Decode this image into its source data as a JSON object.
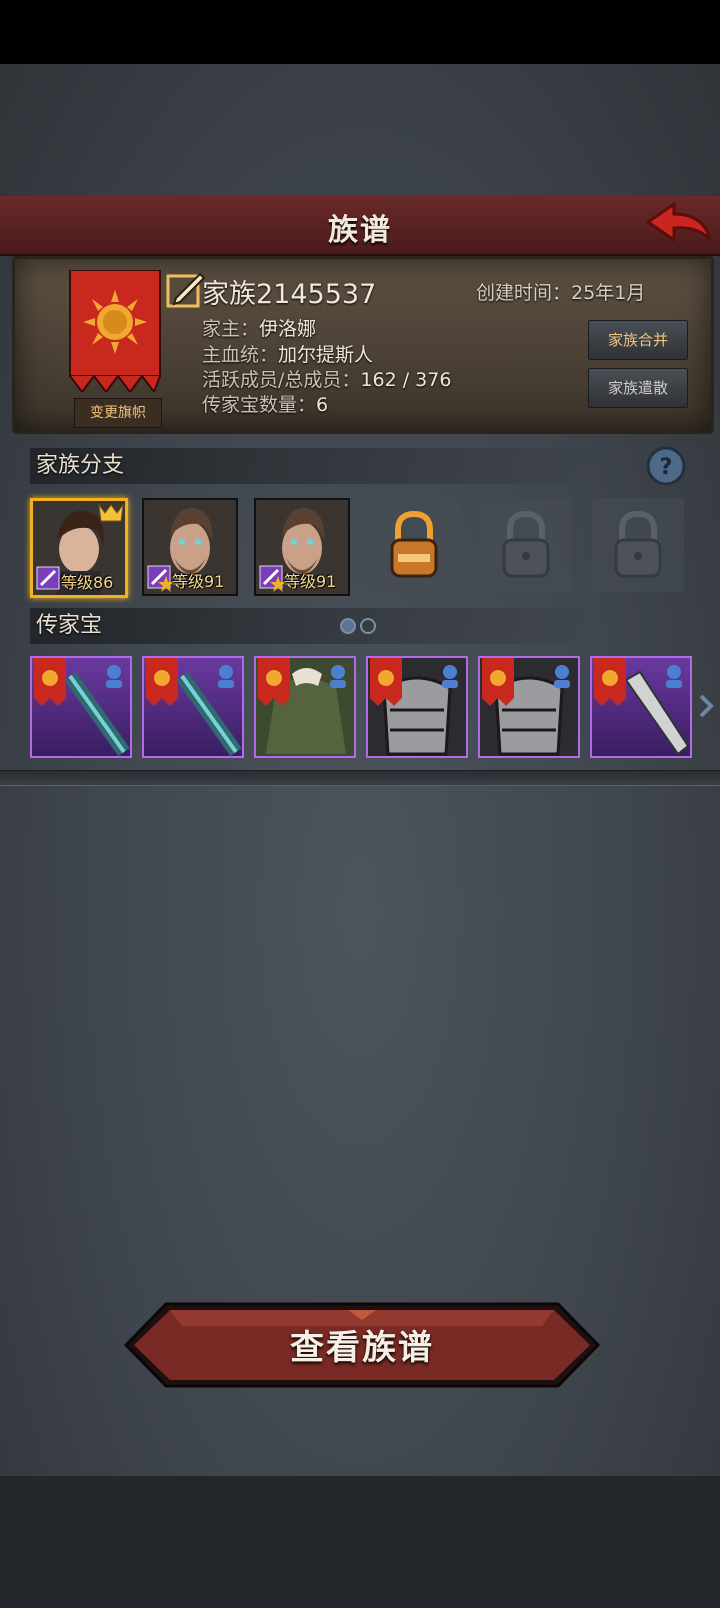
{
  "header": {
    "title": "族谱"
  },
  "family": {
    "name": "家族2145537",
    "created_label": "创建时间：",
    "created_value": "25年1月",
    "leader_label": "家主：",
    "leader_value": "伊洛娜",
    "bloodline_label": "主血统：",
    "bloodline_value": "加尔提斯人",
    "members_label": "活跃成员/总成员：",
    "members_value": "162 / 376",
    "heirloom_count_label": "传家宝数量：",
    "heirloom_count_value": "6",
    "change_flag_label": "变更旗帜",
    "merge_label": "家族合并",
    "disband_label": "家族遣散"
  },
  "branches": {
    "title": "家族分支",
    "heroes": [
      {
        "level": "等级86"
      },
      {
        "level": "等级91"
      },
      {
        "level": "等级91"
      }
    ]
  },
  "heirlooms": {
    "title": "传家宝"
  },
  "footer": {
    "view_button": "查看族谱"
  },
  "colors": {
    "accent_gold": "#f3b21d",
    "title_red": "#6a2a28",
    "heirloom_purple": "#b06ce8"
  }
}
